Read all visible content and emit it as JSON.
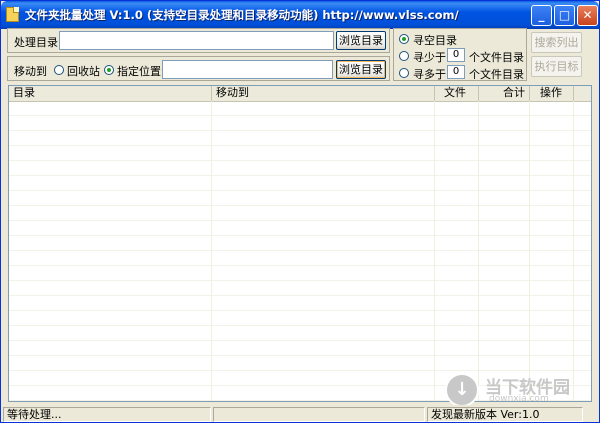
{
  "window": {
    "title": "文件夹批量处理 V:1.0 (支持空目录处理和目录移动功能) http://www.vlss.com/",
    "minimize_label": "_",
    "maximize_label": "□",
    "close_label": "✕"
  },
  "source": {
    "label": "处理目录",
    "value": "",
    "browse_label": "浏览目录"
  },
  "move": {
    "label": "移动到",
    "recycle_label": "回收站",
    "recycle_checked": false,
    "custom_label": "指定位置",
    "custom_checked": true,
    "value": "",
    "browse_label": "浏览目录"
  },
  "filter": {
    "empty_label": "寻空目录",
    "empty_checked": true,
    "less_prefix": "寻少于",
    "less_value": "0",
    "less_suffix": "个文件目录",
    "more_prefix": "寻多于",
    "more_value": "0",
    "more_suffix": "个文件目录"
  },
  "actions": {
    "search_label": "搜索列出",
    "execute_label": "执行目标"
  },
  "table": {
    "columns": [
      "目录",
      "移动到",
      "文件",
      "合计",
      "操作"
    ]
  },
  "status": {
    "left": "等待处理...",
    "middle": "",
    "right": "发现最新版本 Ver:1.0"
  },
  "watermark": {
    "name": "当下软件园",
    "url": "downxia.com"
  }
}
